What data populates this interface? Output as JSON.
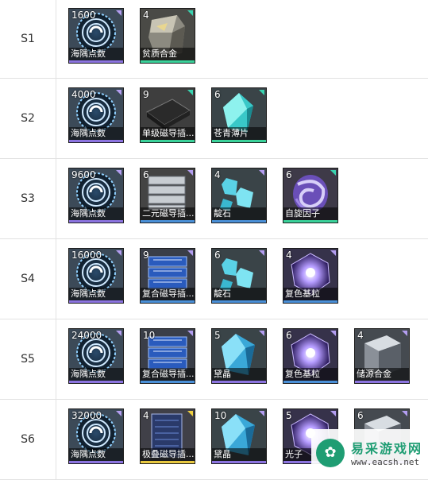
{
  "rows": [
    {
      "stage": "S1",
      "items": [
        {
          "qty": "1600",
          "label": "海隅点数",
          "art": "coin",
          "corner": "purple",
          "bar": "purple"
        },
        {
          "qty": "4",
          "label": "贫质合金",
          "art": "ore",
          "corner": "green",
          "bar": "green"
        }
      ]
    },
    {
      "stage": "S2",
      "items": [
        {
          "qty": "4000",
          "label": "海隅点数",
          "art": "coin",
          "corner": "purple",
          "bar": "purple"
        },
        {
          "qty": "9",
          "label": "单级磁导插...",
          "art": "plate",
          "corner": "green",
          "bar": "green"
        },
        {
          "qty": "6",
          "label": "苍青薄片",
          "art": "shard",
          "corner": "green",
          "bar": "green"
        }
      ]
    },
    {
      "stage": "S3",
      "items": [
        {
          "qty": "9600",
          "label": "海隅点数",
          "art": "coin",
          "corner": "purple",
          "bar": "purple"
        },
        {
          "qty": "6",
          "label": "二元磁导插...",
          "art": "stack",
          "corner": "blue",
          "bar": "blue"
        },
        {
          "qty": "4",
          "label": "靛石",
          "art": "crystal",
          "corner": "blue",
          "bar": "blue"
        },
        {
          "qty": "6",
          "label": "自旋因子",
          "art": "spiral",
          "corner": "green",
          "bar": "green"
        }
      ]
    },
    {
      "stage": "S4",
      "items": [
        {
          "qty": "16000",
          "label": "海隅点数",
          "art": "coin",
          "corner": "purple",
          "bar": "purple"
        },
        {
          "qty": "9",
          "label": "复合磁导插...",
          "art": "bluestack",
          "corner": "blue",
          "bar": "blue"
        },
        {
          "qty": "6",
          "label": "靛石",
          "art": "crystal",
          "corner": "blue",
          "bar": "blue"
        },
        {
          "qty": "4",
          "label": "复色基粒",
          "art": "orb",
          "corner": "blue",
          "bar": "blue"
        }
      ]
    },
    {
      "stage": "S5",
      "items": [
        {
          "qty": "24000",
          "label": "海隅点数",
          "art": "coin",
          "corner": "purple",
          "bar": "purple"
        },
        {
          "qty": "10",
          "label": "复合磁导插...",
          "art": "bluestack",
          "corner": "blue",
          "bar": "blue"
        },
        {
          "qty": "5",
          "label": "黛晶",
          "art": "bigcrystal",
          "corner": "purple",
          "bar": "purple"
        },
        {
          "qty": "6",
          "label": "复色基粒",
          "art": "orb",
          "corner": "blue",
          "bar": "blue"
        },
        {
          "qty": "4",
          "label": "储源合金",
          "art": "cube",
          "corner": "purple",
          "bar": "purple"
        }
      ]
    },
    {
      "stage": "S6",
      "items": [
        {
          "qty": "32000",
          "label": "海隅点数",
          "art": "coin",
          "corner": "purple",
          "bar": "purple"
        },
        {
          "qty": "4",
          "label": "极叠磁导插...",
          "art": "tall",
          "corner": "yellow",
          "bar": "yellow"
        },
        {
          "qty": "10",
          "label": "黛晶",
          "art": "bigcrystal",
          "corner": "purple",
          "bar": "purple"
        },
        {
          "qty": "5",
          "label": "光子",
          "art": "orb",
          "corner": "purple",
          "bar": "purple"
        },
        {
          "qty": "6",
          "label": "",
          "art": "cube",
          "corner": "purple",
          "bar": "purple"
        }
      ]
    }
  ],
  "watermark": {
    "title": "易采游戏网",
    "url": "www.eacsh.net",
    "logo_icon": "leaf-icon"
  }
}
